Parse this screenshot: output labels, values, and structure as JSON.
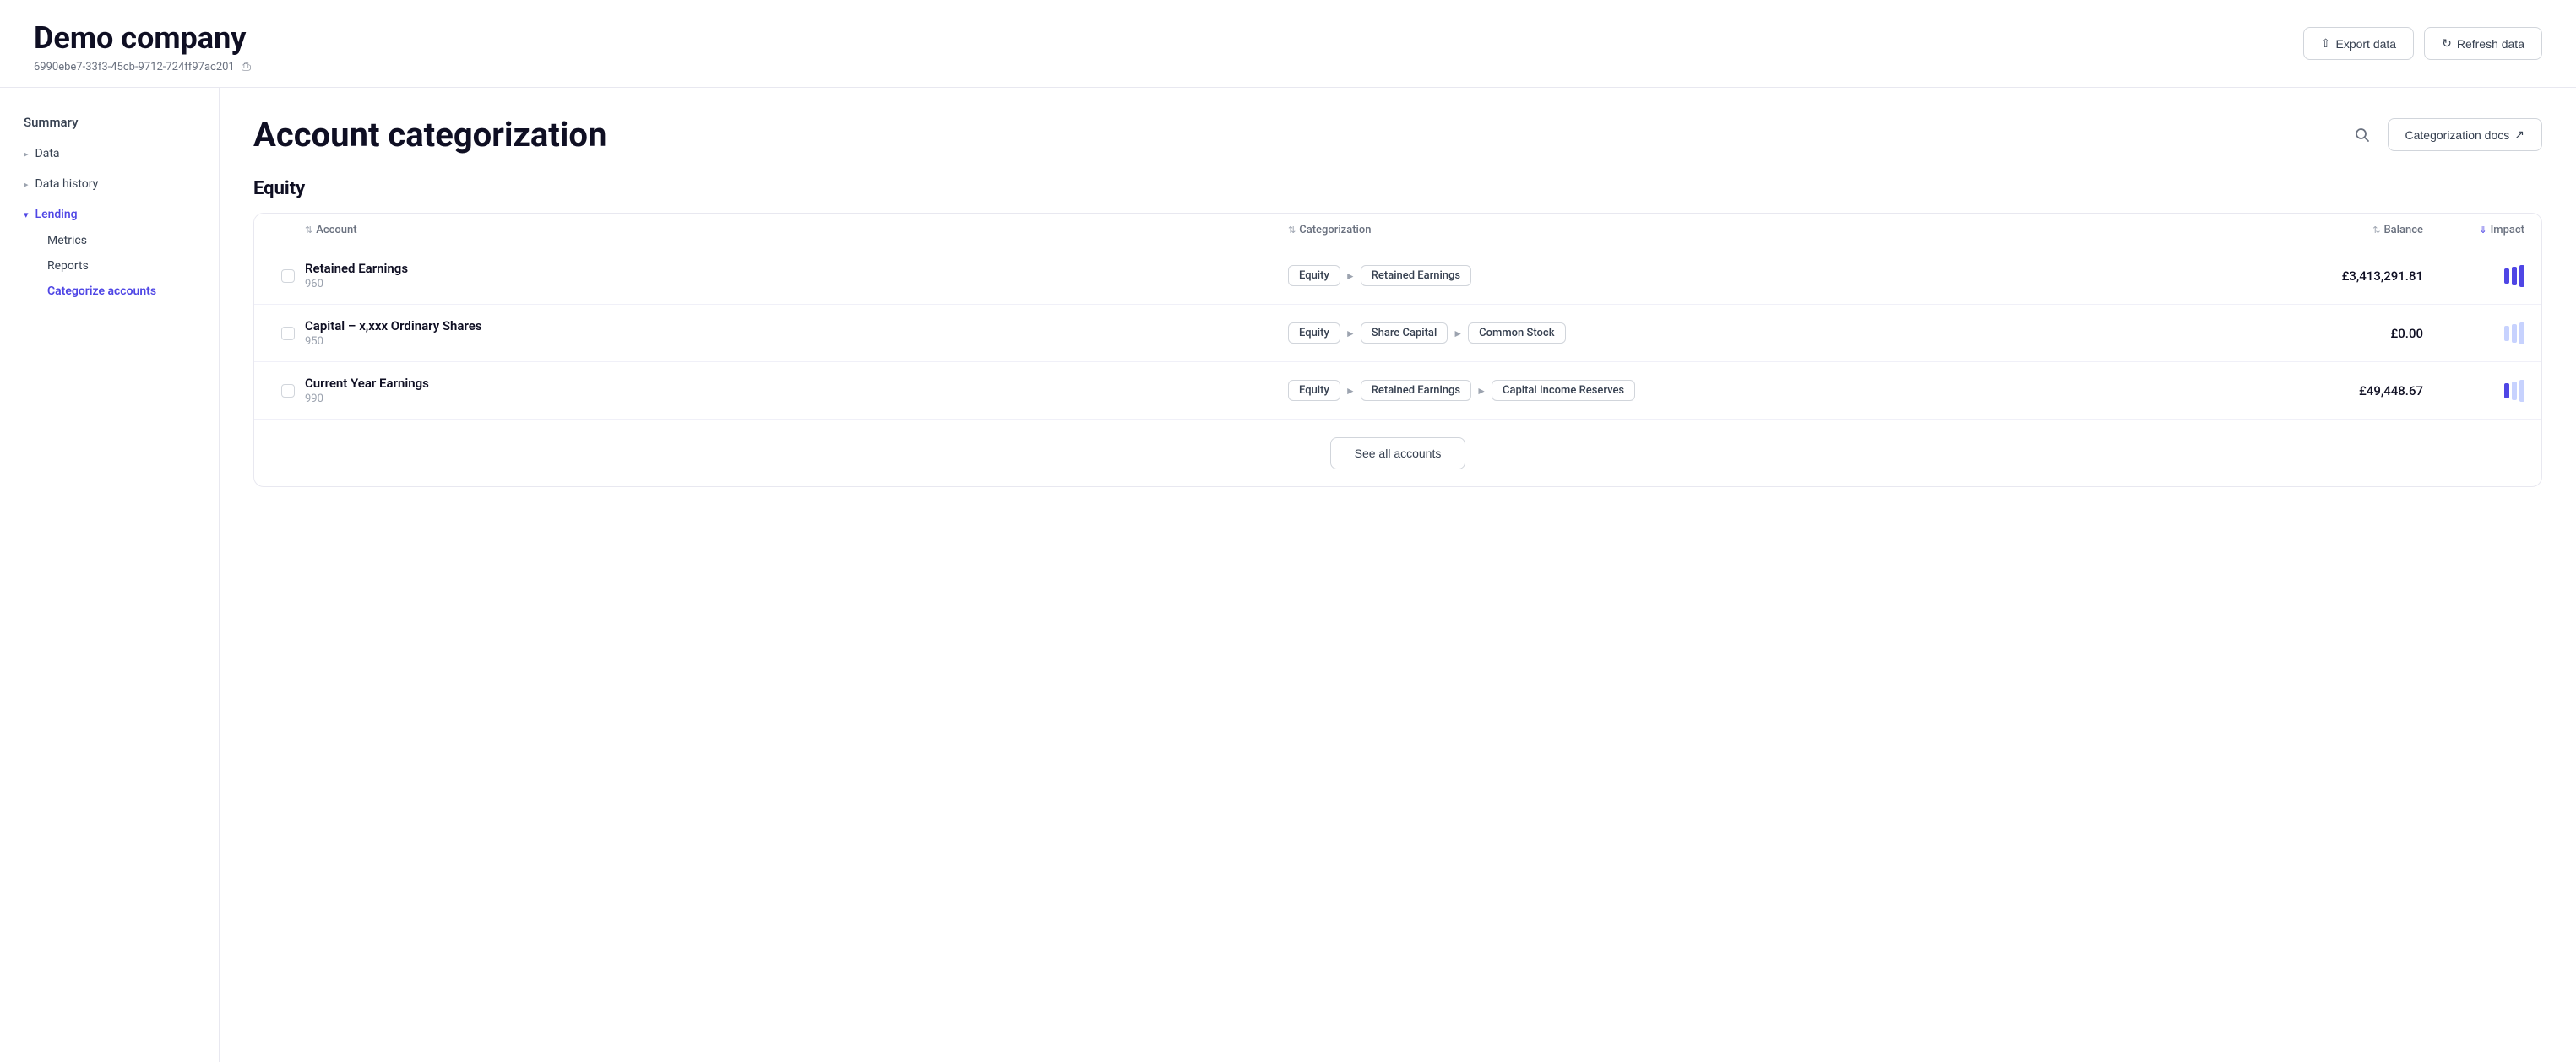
{
  "header": {
    "company_name": "Demo company",
    "company_id": "6990ebe7-33f3-45cb-9712-724ff97ac201",
    "export_label": "Export data",
    "refresh_label": "Refresh data"
  },
  "sidebar": {
    "summary_label": "Summary",
    "items": [
      {
        "id": "data",
        "label": "Data",
        "expanded": false
      },
      {
        "id": "data-history",
        "label": "Data history",
        "expanded": false
      },
      {
        "id": "lending",
        "label": "Lending",
        "expanded": true
      }
    ],
    "lending_sub_items": [
      {
        "id": "metrics",
        "label": "Metrics",
        "active": false
      },
      {
        "id": "reports",
        "label": "Reports",
        "active": false
      },
      {
        "id": "categorize-accounts",
        "label": "Categorize accounts",
        "active": true
      }
    ]
  },
  "content": {
    "page_title": "Account categorization",
    "docs_btn_label": "Categorization docs",
    "section_title": "Equity",
    "columns": {
      "account": "Account",
      "categorization": "Categorization",
      "balance": "Balance",
      "impact": "Impact"
    },
    "rows": [
      {
        "account_name": "Retained Earnings",
        "account_code": "960",
        "cat1": "Equity",
        "cat2": "Retained Earnings",
        "cat3": null,
        "balance": "£3,413,291.81",
        "impact_bars": [
          3,
          3,
          3
        ]
      },
      {
        "account_name": "Capital – x,xxx Ordinary Shares",
        "account_code": "950",
        "cat1": "Equity",
        "cat2": "Share Capital",
        "cat3": "Common Stock",
        "balance": "£0.00",
        "impact_bars": [
          2,
          2,
          2
        ]
      },
      {
        "account_name": "Current Year Earnings",
        "account_code": "990",
        "cat1": "Equity",
        "cat2": "Retained Earnings",
        "cat3": "Capital Income Reserves",
        "balance": "£49,448.67",
        "impact_bars": [
          1,
          2,
          2
        ]
      }
    ],
    "see_all_label": "See all accounts"
  }
}
